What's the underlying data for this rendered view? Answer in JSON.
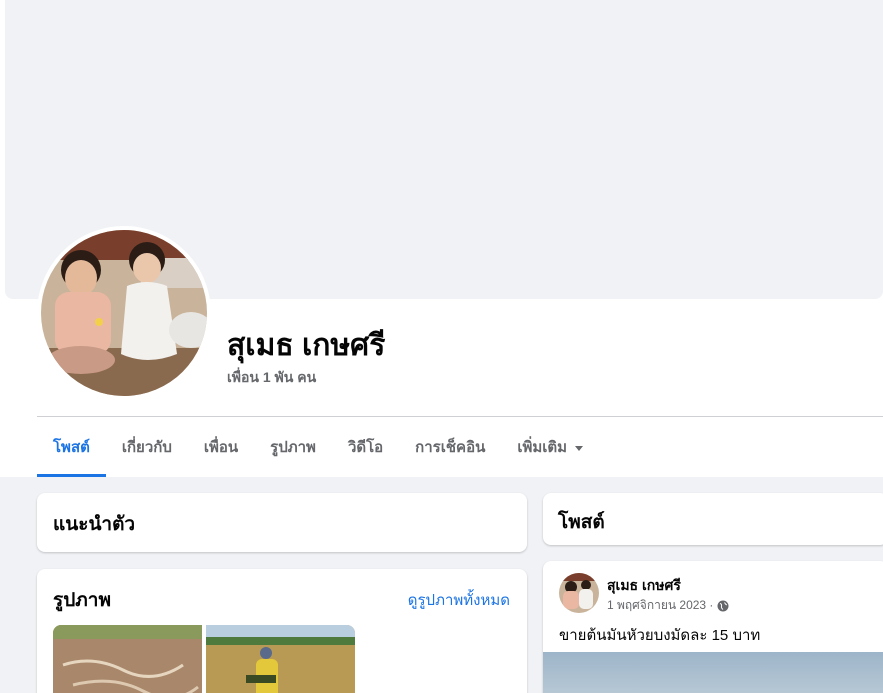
{
  "profile": {
    "name": "สุเมธ เกษศรี",
    "friends": "เพื่อน 1 พัน คน"
  },
  "tabs": [
    {
      "label": "โพสต์",
      "active": true
    },
    {
      "label": "เกี่ยวกับ",
      "active": false
    },
    {
      "label": "เพื่อน",
      "active": false
    },
    {
      "label": "รูปภาพ",
      "active": false
    },
    {
      "label": "วิดีโอ",
      "active": false
    },
    {
      "label": "การเช็คอิน",
      "active": false
    },
    {
      "label": "เพิ่มเติม",
      "active": false
    }
  ],
  "intro": {
    "title": "แนะนำตัว"
  },
  "photos": {
    "title": "รูปภาพ",
    "see_all": "ดูรูปภาพทั้งหมด"
  },
  "posts": {
    "title": "โพสต์",
    "items": [
      {
        "author": "สุเมธ เกษศรี",
        "date": "1 พฤศจิกายน 2023 ·",
        "text": "ขายต้นมันหัวยบงมัดละ 15 บาท",
        "privacy_icon": "globe-icon"
      }
    ]
  },
  "colors": {
    "accent": "#1b74e4",
    "background": "#f0f2f5",
    "secondary_text": "#65676b"
  }
}
